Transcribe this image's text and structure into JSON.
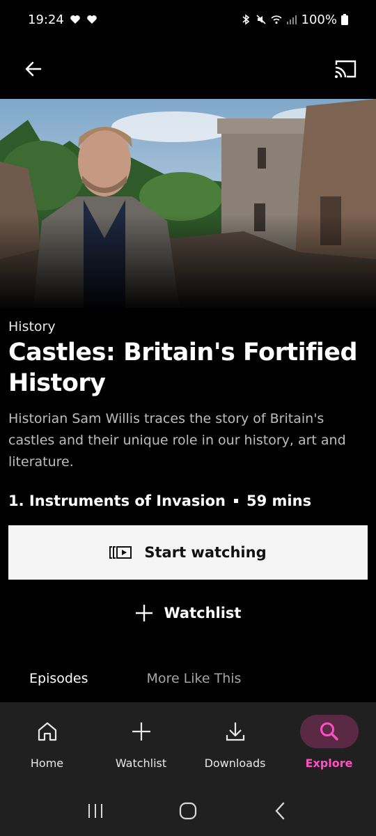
{
  "status_bar": {
    "time": "19:24",
    "battery": "100%"
  },
  "top_bar": {
    "back_icon": "arrow-left-icon",
    "cast_icon": "cast-icon"
  },
  "programme": {
    "genre": "History",
    "title": "Castles: Britain's Fortified History",
    "description": "Historian Sam Willis traces the story of Britain's castles and their unique role in our history, art and literature.",
    "episode_title": "1. Instruments of Invasion",
    "duration": "59 mins"
  },
  "actions": {
    "start_watching_label": "Start watching",
    "watchlist_label": "Watchlist"
  },
  "tabs": [
    {
      "label": "Episodes",
      "active": true
    },
    {
      "label": "More Like This",
      "active": false
    }
  ],
  "bottom_nav": {
    "items": [
      {
        "label": "Home",
        "icon": "home-icon",
        "active": false
      },
      {
        "label": "Watchlist",
        "icon": "plus-icon",
        "active": false
      },
      {
        "label": "Downloads",
        "icon": "download-icon",
        "active": false
      },
      {
        "label": "Explore",
        "icon": "search-icon",
        "active": true
      }
    ]
  },
  "colors": {
    "accent": "#ff4fc6",
    "background": "#000000",
    "nav_background": "#202020"
  }
}
